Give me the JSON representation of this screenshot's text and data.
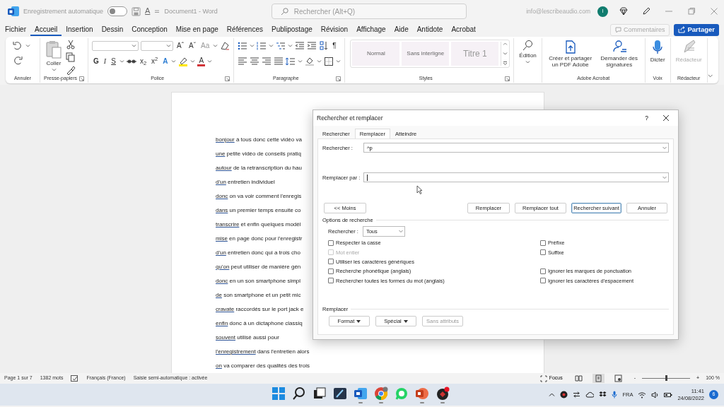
{
  "title_bar": {
    "autosave_label": "Enregistrement automatique",
    "autosave_on": false,
    "qat_letter": "A",
    "document_title": "Document1 - Word",
    "search_placeholder": "Rechercher (Alt+Q)",
    "account": "info@lescribeaudio.com",
    "avatar": "I"
  },
  "menu_tabs": [
    {
      "label": "Fichier",
      "selected": false
    },
    {
      "label": "Accueil",
      "selected": true
    },
    {
      "label": "Insertion",
      "selected": false
    },
    {
      "label": "Dessin",
      "selected": false
    },
    {
      "label": "Conception",
      "selected": false
    },
    {
      "label": "Mise en page",
      "selected": false
    },
    {
      "label": "Références",
      "selected": false
    },
    {
      "label": "Publipostage",
      "selected": false
    },
    {
      "label": "Révision",
      "selected": false
    },
    {
      "label": "Affichage",
      "selected": false
    },
    {
      "label": "Aide",
      "selected": false
    },
    {
      "label": "Antidote",
      "selected": false
    },
    {
      "label": "Acrobat",
      "selected": false
    }
  ],
  "header_buttons": {
    "comments": "Commentaires",
    "share": "Partager"
  },
  "ribbon": {
    "groups": [
      {
        "kind": "undo",
        "label": "Annuler",
        "launcher": false
      },
      {
        "kind": "clipboard",
        "label": "Presse-papiers",
        "launcher": true,
        "paste": "Coller"
      },
      {
        "kind": "font",
        "label": "Police",
        "launcher": true,
        "row1": [
          "Aˆ",
          "Aˇ",
          "Aa"
        ],
        "row2": [
          "G",
          "I",
          "S",
          "x$_{2}$",
          "x$^{2}$",
          "A",
          "A"
        ]
      },
      {
        "kind": "paragraph",
        "label": "Paragraphe",
        "launcher": true,
        "pilcrow": "¶"
      },
      {
        "kind": "styles",
        "label": "Styles",
        "launcher": true,
        "styles": [
          {
            "label": "Normal",
            "kind": "body"
          },
          {
            "label": "Sans interligne",
            "kind": "body"
          },
          {
            "label": "Titre 1",
            "kind": "heading"
          }
        ]
      },
      {
        "kind": "editing",
        "launcher": false,
        "button": "Édition"
      },
      {
        "kind": "acrobat",
        "label": "Adobe Acrobat",
        "launcher": false,
        "buttons": [
          "Créer et partager un PDF Adobe",
          "Demander des signatures"
        ]
      },
      {
        "kind": "voice",
        "label": "Voix",
        "launcher": false,
        "button": "Dicter"
      },
      {
        "kind": "editor",
        "label": "Rédacteur",
        "launcher": false,
        "button": "Rédacteur",
        "disabled": true
      }
    ]
  },
  "document": {
    "lines": [
      {
        "marked": "bonjour",
        "text": "à tous donc cette vidéo va"
      },
      {
        "marked": "une",
        "text": "petite vidéo de conseils pratiq"
      },
      {
        "marked": "autour",
        "text": "de la retranscription du hau"
      },
      {
        "marked": "d'un",
        "text": "entretien individuel"
      },
      {
        "marked": "donc",
        "text": "on va voir comment l'enregis"
      },
      {
        "marked": "dans",
        "text": "un premier temps ensuite co"
      },
      {
        "marked": "transcrire",
        "text": "et enfin quelques modèl"
      },
      {
        "marked": "mise",
        "text": "en page donc pour l'enregistr"
      },
      {
        "marked": "d'un",
        "text": "entretien donc qui a trois cho"
      },
      {
        "marked": "qu'on",
        "text": "peut utiliser de manière gén"
      },
      {
        "marked": "donc",
        "text": "en un son smartphone simpl"
      },
      {
        "marked": "de",
        "text": "son smartphone et un petit mic"
      },
      {
        "marked": "cravate",
        "text": "raccordés sur le port jack e"
      },
      {
        "marked": "enfin",
        "text": "donc à un dictaphone classiq"
      },
      {
        "marked": "souvent",
        "text": "utilisé aussi pour"
      },
      {
        "marked": "l'enregistrement",
        "text": "dans l'entretien alors"
      },
      {
        "marked": "on",
        "text": "va comparer des qualités des trois"
      }
    ]
  },
  "dialog": {
    "title": "Rechercher et remplacer",
    "help": "?",
    "tabs": [
      {
        "label": "Rechercher",
        "selected": false
      },
      {
        "label": "Remplacer",
        "selected": true
      },
      {
        "label": "Atteindre",
        "selected": false
      }
    ],
    "find": {
      "label": "Rechercher :",
      "value": "^p"
    },
    "replace": {
      "label": "Remplacer par :"
    },
    "buttons": [
      {
        "label": "<< Moins",
        "default": false
      },
      {
        "label": "Remplacer",
        "default": false
      },
      {
        "label": "Remplacer tout",
        "default": false
      },
      {
        "label": "Rechercher suivant",
        "default": true
      },
      {
        "label": "Annuler",
        "default": false
      }
    ],
    "options_title": "Options de recherche",
    "search_scope": {
      "label": "Rechercher :",
      "value": "Tous"
    },
    "option_rows": [
      [
        {
          "label": "Respecter la casse",
          "checked": false,
          "disabled": false
        },
        {
          "label": "Préfixe",
          "checked": false,
          "disabled": false
        }
      ],
      [
        {
          "label": "Mot entier",
          "checked": false,
          "disabled": true
        },
        {
          "label": "Suffixe",
          "checked": false,
          "disabled": false
        }
      ],
      [
        {
          "label": "Utiliser les caractères génériques",
          "checked": false,
          "disabled": false
        }
      ],
      [
        {
          "label": "Recherche phonétique (anglais)",
          "checked": false,
          "disabled": false
        },
        {
          "label": "Ignorer les marques de ponctuation",
          "checked": false,
          "disabled": false
        }
      ],
      [
        {
          "label": "Rechercher toutes les formes du mot (anglais)",
          "checked": false,
          "disabled": false
        },
        {
          "label": "Ignorer les caractères d'espacement",
          "checked": false,
          "disabled": false
        }
      ]
    ],
    "replace_title": "Remplacer",
    "replace_buttons": [
      {
        "label": "Format",
        "menu": true,
        "disabled": false
      },
      {
        "label": "Spécial",
        "menu": true,
        "disabled": false
      },
      {
        "label": "Sans attributs",
        "menu": false,
        "disabled": true
      }
    ]
  },
  "status_bar": {
    "page": "Page 1 sur 7",
    "words": "1382 mots",
    "language": "Français (France)",
    "autocomplete": "Saisie semi-automatique : activée",
    "focus": "Focus",
    "views": [
      {
        "selected": false
      },
      {
        "selected": true
      },
      {
        "selected": false
      }
    ],
    "zoom": {
      "minus": "-",
      "plus": "+",
      "level": 0.5,
      "reading": "100 %"
    }
  },
  "taskbar": {
    "apps": [
      {
        "running": false
      },
      {
        "running": false
      },
      {
        "running": false
      },
      {
        "running": false
      },
      {
        "running": true
      },
      {
        "running": true
      },
      {
        "running": false
      },
      {
        "running": true
      },
      {
        "running": true
      }
    ],
    "language": "FRA",
    "time": "11:41",
    "date": "24/08/2022",
    "notifications": "6"
  }
}
